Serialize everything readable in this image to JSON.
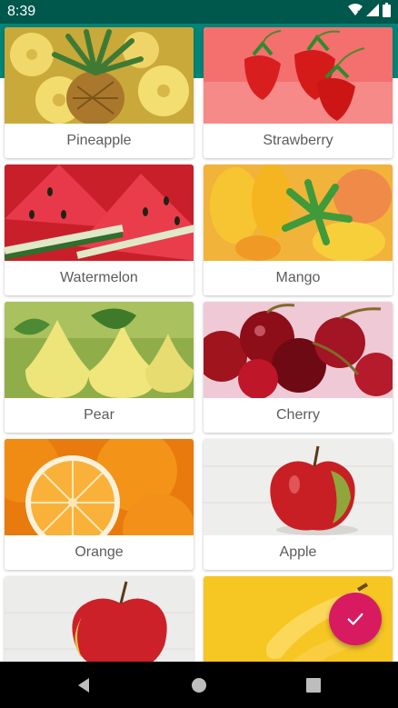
{
  "status_bar": {
    "time": "8:39",
    "icons": [
      "wifi-icon",
      "signal-icon",
      "battery-icon"
    ]
  },
  "colors": {
    "primary": "#008577",
    "primary_dark": "#00574B",
    "accent": "#D81B60"
  },
  "fruits": [
    {
      "name": "Pineapple"
    },
    {
      "name": "Strawberry"
    },
    {
      "name": "Watermelon"
    },
    {
      "name": "Mango"
    },
    {
      "name": "Pear"
    },
    {
      "name": "Cherry"
    },
    {
      "name": "Orange"
    },
    {
      "name": "Apple"
    },
    {
      "name": ""
    },
    {
      "name": ""
    }
  ],
  "fab": {
    "icon": "check-icon"
  },
  "nav_bar": {
    "icons": [
      "back-icon",
      "home-icon",
      "recents-icon"
    ]
  }
}
